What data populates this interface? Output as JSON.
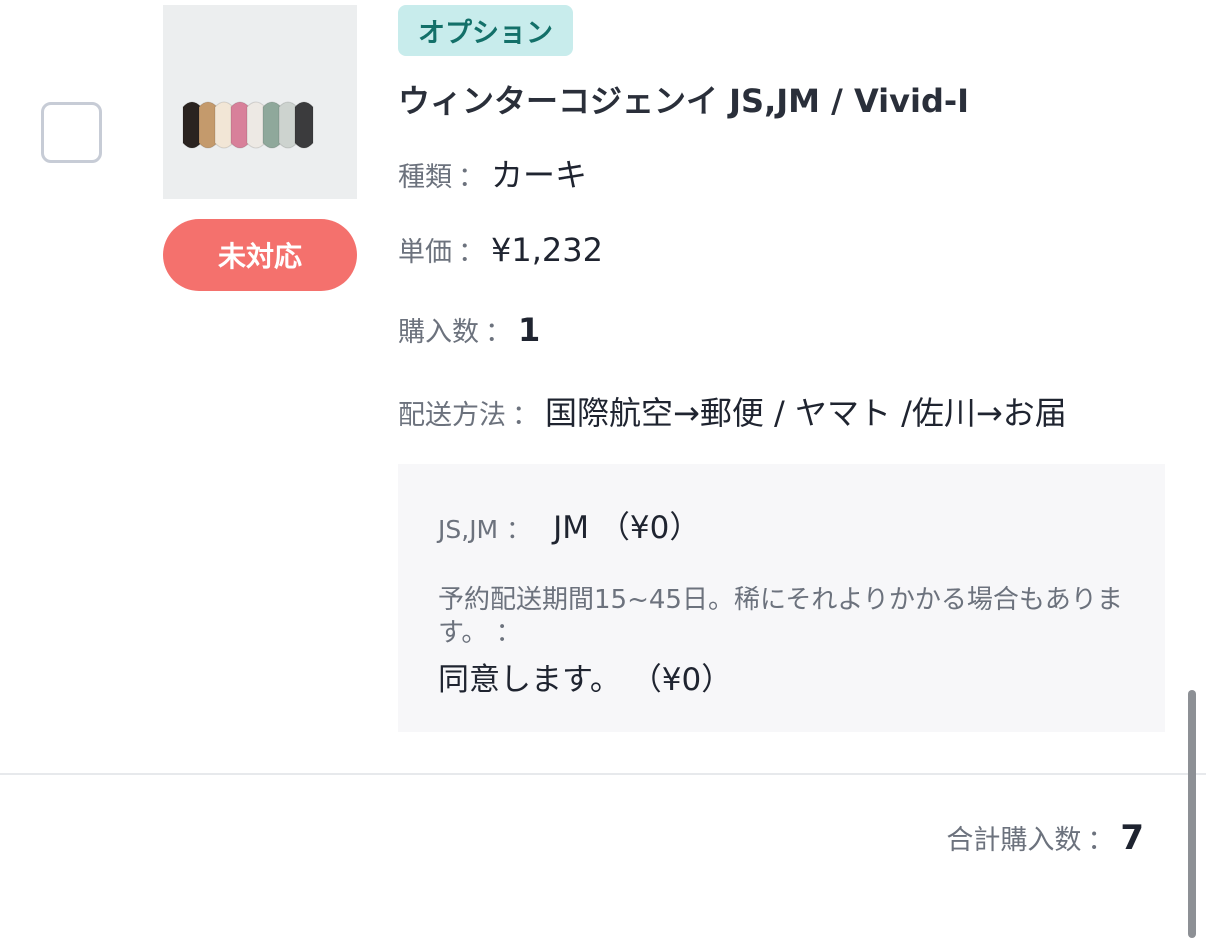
{
  "item": {
    "option_tag": "オプション",
    "status_badge": "未対応",
    "title": "ウィンターコジェンイ JS,JM / Vivid-I",
    "specs": {
      "type_label": "種類",
      "type_value": "カーキ",
      "price_label": "単価",
      "price_value": "¥1,232",
      "qty_label": "購入数",
      "qty_value": "1",
      "shipping_label": "配送方法",
      "shipping_value": "国際航空→郵便 / ヤマト /佐川→お届"
    },
    "separator": "：",
    "options": [
      {
        "label": "JS,JM",
        "value": "JM （¥0）"
      },
      {
        "label": "予約配送期間15~45日。稀にそれよりかかる場合もあります。",
        "value": "同意します。 （¥0）"
      }
    ],
    "thumbnail_colors": [
      "#2a2320",
      "#c49a6c",
      "#f2e6d6",
      "#d8809a",
      "#ede9e4",
      "#8fa89b",
      "#cdd3cf",
      "#3b3b3d"
    ]
  },
  "summary": {
    "total_label": "合計購入数",
    "total_value": "7"
  },
  "colors": {
    "badge_red": "#f4716d",
    "tag_bg": "#c8ecec",
    "tag_text": "#137069"
  }
}
